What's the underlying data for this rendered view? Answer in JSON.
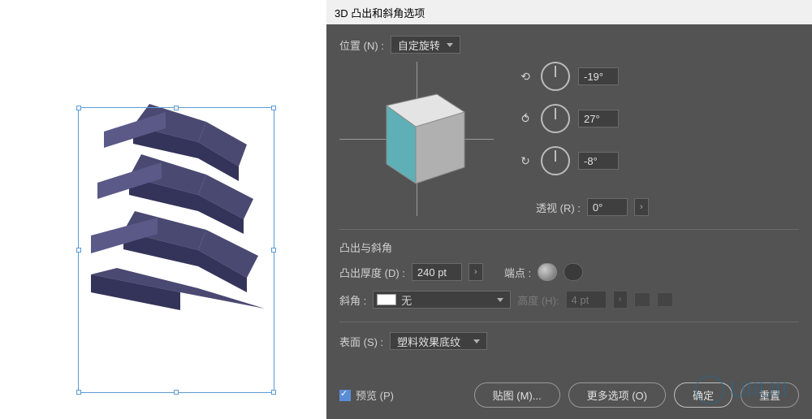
{
  "dialog": {
    "title": "3D 凸出和斜角选项",
    "position_label": "位置 (N) :",
    "position_value": "自定旋转",
    "rotation": {
      "x": "-19°",
      "y": "27°",
      "z": "-8°"
    },
    "perspective_label": "透视 (R) :",
    "perspective_value": "0°",
    "extrude_section_title": "凸出与斜角",
    "extrude_depth_label": "凸出厚度 (D) :",
    "extrude_depth_value": "240 pt",
    "cap_label": "端点 :",
    "bevel_label": "斜角 :",
    "bevel_value": "无",
    "height_label": "高度 (H):",
    "height_value": "4 pt",
    "surface_label": "表面 (S) :",
    "surface_value": "塑料效果底纹",
    "preview_label": "预览 (P)",
    "map_art_btn": "贴图 (M)...",
    "more_options_btn": "更多选项 (O)",
    "ok_btn": "确定",
    "reset_btn": "重置"
  },
  "colors": {
    "cube_face1": "#5eb0b6",
    "cube_face2": "#bababa",
    "cube_face3": "#e4e4e4",
    "building": "#4a4972",
    "building_dark": "#34345a"
  },
  "watermark_text": "UIIUII"
}
